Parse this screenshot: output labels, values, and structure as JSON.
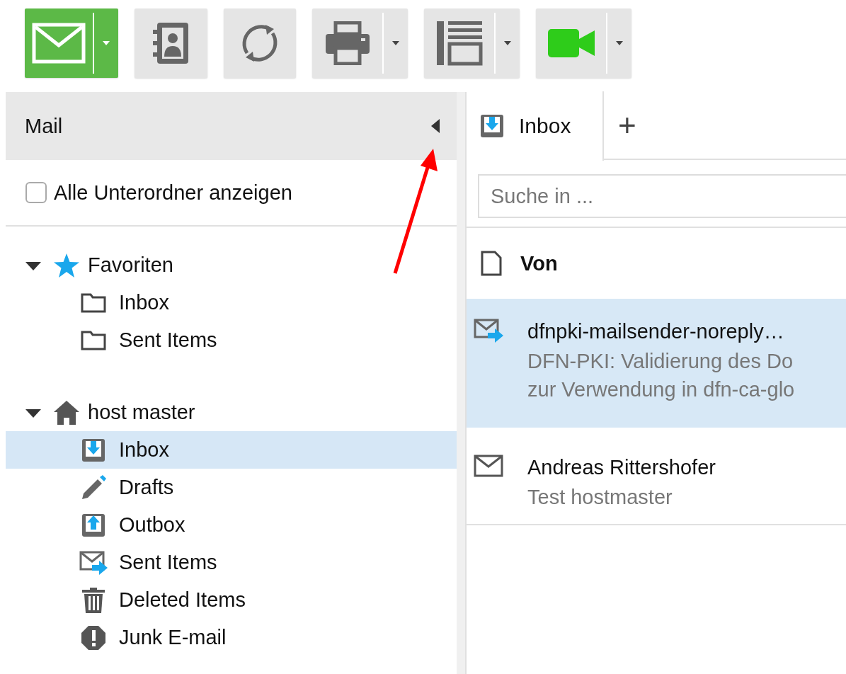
{
  "toolbar": {
    "buttons": [
      {
        "kind": "mail",
        "dropdown": true,
        "primary": true
      },
      {
        "kind": "contacts",
        "dropdown": false,
        "primary": false
      },
      {
        "kind": "sync",
        "dropdown": false,
        "primary": false
      },
      {
        "kind": "print",
        "dropdown": true,
        "primary": false
      },
      {
        "kind": "layout",
        "dropdown": true,
        "primary": false
      },
      {
        "kind": "video",
        "dropdown": true,
        "primary": false
      }
    ]
  },
  "sidebar": {
    "title": "Mail",
    "show_subfolders": {
      "label": "Alle Unterordner anzeigen",
      "checked": false
    },
    "tree": [
      {
        "label": "Favoriten",
        "kind": "favorites",
        "expanded": true,
        "children": [
          {
            "label": "Inbox",
            "kind": "folder",
            "selected": false
          },
          {
            "label": "Sent Items",
            "kind": "folder",
            "selected": false
          }
        ]
      },
      {
        "label": "host master",
        "kind": "account",
        "expanded": true,
        "children": [
          {
            "label": "Inbox",
            "kind": "inbox",
            "selected": true
          },
          {
            "label": "Drafts",
            "kind": "drafts",
            "selected": false
          },
          {
            "label": "Outbox",
            "kind": "outbox",
            "selected": false
          },
          {
            "label": "Sent Items",
            "kind": "sent",
            "selected": false
          },
          {
            "label": "Deleted Items",
            "kind": "trash",
            "selected": false
          },
          {
            "label": "Junk E-mail",
            "kind": "junk",
            "selected": false
          }
        ]
      }
    ]
  },
  "tabs": [
    {
      "label": "Inbox",
      "selected": true
    }
  ],
  "add_tab": "+",
  "search": {
    "placeholder": "Suche in ..."
  },
  "list": {
    "column": "Von",
    "messages": [
      {
        "sender": "dfnpki-mailsender-noreply…",
        "subject_lines": [
          "DFN-PKI: Validierung des Do",
          "zur Verwendung in dfn-ca-glo"
        ],
        "kind": "forwarded",
        "selected": true
      },
      {
        "sender": "Andreas Rittershofer",
        "subject_lines": [
          "Test hostmaster"
        ],
        "kind": "plain",
        "selected": false
      }
    ]
  }
}
